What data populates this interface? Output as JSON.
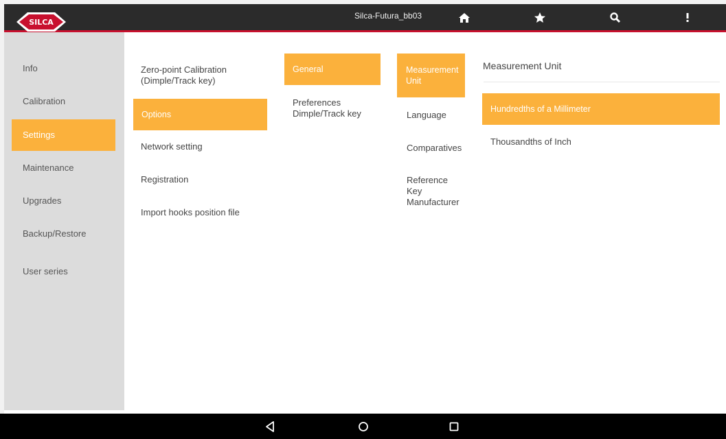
{
  "header": {
    "logo_text": "SILCA",
    "title": "Silca-Futura_bb03",
    "icons": [
      "home-icon",
      "star-icon",
      "search-icon",
      "overflow-menu-icon"
    ]
  },
  "sidebar": {
    "items": [
      {
        "label": "Info"
      },
      {
        "label": "Calibration"
      },
      {
        "label": "Settings",
        "active": true
      },
      {
        "label": "Maintenance"
      },
      {
        "label": "Upgrades"
      },
      {
        "label": "Backup/Restore"
      },
      {
        "label": "User series"
      }
    ]
  },
  "col1": {
    "zero_point": "Zero-point Calibration\n(Dimple/Track key)",
    "options": "Options",
    "network": "Network setting",
    "registration": "Registration",
    "import_hooks": "Import hooks position file"
  },
  "col2": {
    "general": "General",
    "preferences": "Preferences\nDimple/Track key"
  },
  "col3": {
    "measurement_unit": "Measurement\nUnit",
    "language": "Language",
    "comparatives": "Comparatives",
    "reference_key": "Reference\nKey\nManufacturer"
  },
  "col4": {
    "heading": "Measurement Unit",
    "options": [
      {
        "label": "Hundredths of a Millimeter",
        "selected": true
      },
      {
        "label": "Thousandths of Inch",
        "selected": false
      }
    ]
  },
  "colors": {
    "accent": "#fbb13c",
    "topbar": "#2b2b2b",
    "brand_red": "#c8102e",
    "sidebar_bg": "#dcdcdc"
  },
  "navbar": {
    "icons": [
      "back-icon",
      "home-circle-icon",
      "recents-icon"
    ]
  }
}
